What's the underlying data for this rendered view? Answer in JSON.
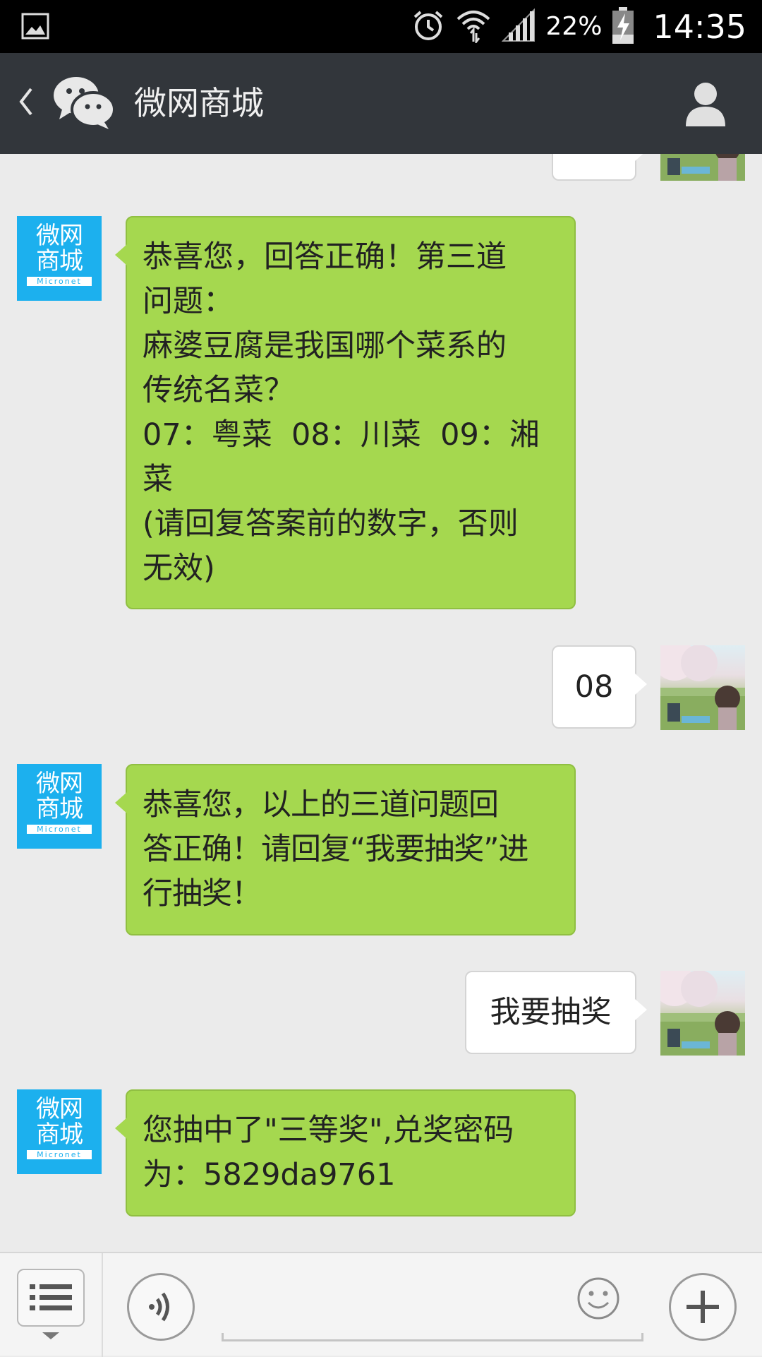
{
  "status_bar": {
    "battery_percent": "22%",
    "time": "14:35",
    "icons": [
      "gallery-icon",
      "alarm-icon",
      "wifi-icon",
      "signal-icon",
      "battery-charging-icon"
    ]
  },
  "header": {
    "title": "微网商城",
    "icons": [
      "back-icon",
      "wechat-logo-icon",
      "profile-icon"
    ]
  },
  "bot": {
    "avatar_text_line1": "微网",
    "avatar_text_line2": "商城",
    "avatar_tag": "Micronet",
    "avatar_color": "#1cb0ee"
  },
  "messages": [
    {
      "from": "bot",
      "lines": [
        "恭喜您，回答正确！第三道",
        "问题：",
        "麻婆豆腐是我国哪个菜系的",
        "传统名菜？",
        "07：粤菜  08：川菜  09：湘",
        "菜",
        "(请回复答案前的数字，否则",
        "无效)"
      ]
    },
    {
      "from": "user",
      "text": "08"
    },
    {
      "from": "bot",
      "lines": [
        "恭喜您，以上的三道问题回",
        "答正确！请回复“我要抽奖”进",
        "行抽奖！"
      ]
    },
    {
      "from": "user",
      "text": "我要抽奖"
    },
    {
      "from": "bot",
      "lines": [
        "您抽中了\"三等奖\",兑奖密码",
        "为：5829da9761"
      ]
    }
  ],
  "input_bar": {
    "icons": [
      "menu-list-icon",
      "voice-icon",
      "emoji-icon",
      "plus-icon"
    ]
  },
  "colors": {
    "incoming_bubble": "#a5d84f",
    "outgoing_bubble": "#ffffff",
    "header_bg": "#32363b",
    "chat_bg": "#ebebeb"
  }
}
